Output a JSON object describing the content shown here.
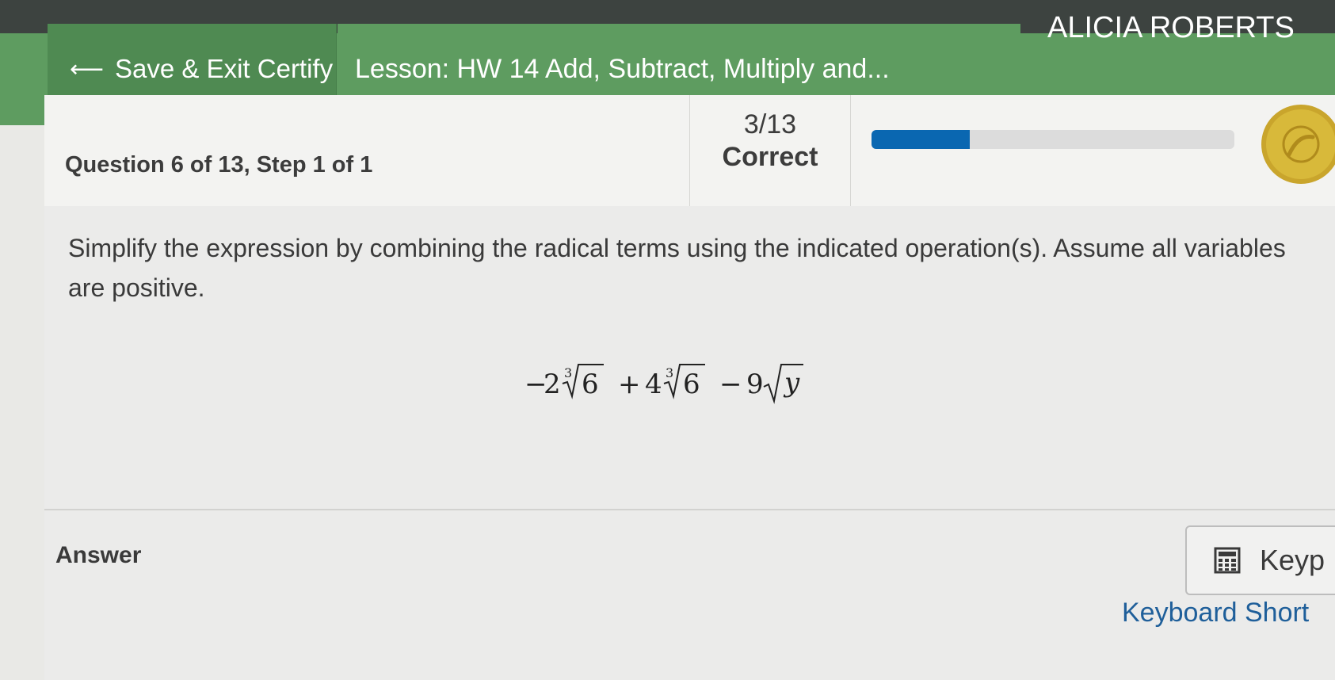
{
  "header": {
    "save_exit_label": "Save & Exit Certify",
    "lesson_title": "Lesson: HW 14 Add, Subtract, Multiply and...",
    "user_name": "ALICIA ROBERTS"
  },
  "question_bar": {
    "title": "Question 6 of 13, Step 1 of 1",
    "score": "3/13",
    "score_label": "Correct",
    "progress_fraction": 0.27
  },
  "question": {
    "prompt": "Simplify the expression by combining the radical terms using the indicated operation(s). Assume all variables are positive.",
    "terms": [
      {
        "sign": "−",
        "coef": "2",
        "index": "3",
        "radicand": "6"
      },
      {
        "sign": "+",
        "coef": "4",
        "index": "3",
        "radicand": "6"
      },
      {
        "sign": "−",
        "coef": "9",
        "index": "",
        "radicand": "y"
      }
    ]
  },
  "answer": {
    "label": "Answer",
    "keypad_label": "Keyp",
    "keyboard_shortcuts_label": "Keyboard Short"
  },
  "colors": {
    "header_green": "#5e9c60",
    "progress_blue": "#0a67b1",
    "link_blue": "#1f5f9a"
  }
}
